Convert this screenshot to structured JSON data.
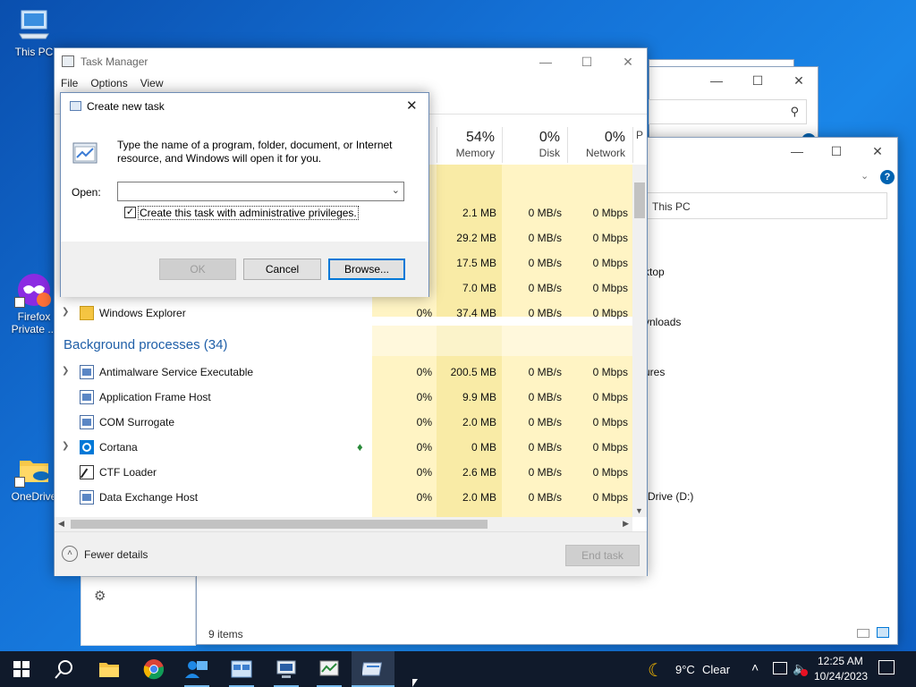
{
  "desktop": {
    "icons": [
      {
        "label": "This PC"
      },
      {
        "label": "Firefox Private ..."
      },
      {
        "label": "OneDrive"
      }
    ]
  },
  "task_manager": {
    "title": "Task Manager",
    "menu": [
      "File",
      "Options",
      "View"
    ],
    "columns": [
      {
        "pct": "54%",
        "name": "Memory"
      },
      {
        "pct": "0%",
        "name": "Disk"
      },
      {
        "pct": "0%",
        "name": "Network"
      },
      {
        "pct": "",
        "name": "P"
      }
    ],
    "apps_rows": [
      {
        "cpu": "",
        "mem": "2.1 MB",
        "disk": "0 MB/s",
        "net": "0 Mbps"
      },
      {
        "cpu": "",
        "mem": "29.2 MB",
        "disk": "0 MB/s",
        "net": "0 Mbps"
      },
      {
        "cpu": "",
        "mem": "17.5 MB",
        "disk": "0 MB/s",
        "net": "0 Mbps"
      },
      {
        "cpu": "",
        "mem": "7.0 MB",
        "disk": "0 MB/s",
        "net": "0 Mbps"
      },
      {
        "name": "Windows Explorer",
        "cpu": "0%",
        "mem": "37.4 MB",
        "disk": "0 MB/s",
        "net": "0 Mbps"
      }
    ],
    "background_header": "Background processes (34)",
    "background_rows": [
      {
        "name": "Antimalware Service Executable",
        "cpu": "0%",
        "mem": "200.5 MB",
        "disk": "0 MB/s",
        "net": "0 Mbps"
      },
      {
        "name": "Application Frame Host",
        "cpu": "0%",
        "mem": "9.9 MB",
        "disk": "0 MB/s",
        "net": "0 Mbps"
      },
      {
        "name": "COM Surrogate",
        "cpu": "0%",
        "mem": "2.0 MB",
        "disk": "0 MB/s",
        "net": "0 Mbps"
      },
      {
        "name": "Cortana",
        "cpu": "0%",
        "mem": "0 MB",
        "disk": "0 MB/s",
        "net": "0 Mbps"
      },
      {
        "name": "CTF Loader",
        "cpu": "0%",
        "mem": "2.6 MB",
        "disk": "0 MB/s",
        "net": "0 Mbps"
      },
      {
        "name": "Data Exchange Host",
        "cpu": "0%",
        "mem": "2.0 MB",
        "disk": "0 MB/s",
        "net": "0 Mbps"
      }
    ],
    "fewer_details": "Fewer details",
    "end_task": "End task"
  },
  "dialog": {
    "title": "Create new task",
    "description": "Type the name of a program, folder, document, or Internet resource, and Windows will open it for you.",
    "open_label": "Open:",
    "open_value": "",
    "admin_checkbox_label": "Create this task with administrative privileges.",
    "admin_checked": true,
    "ok": "OK",
    "cancel": "Cancel",
    "browse": "Browse..."
  },
  "explorer": {
    "address": "This PC",
    "nav_items": [
      "ktop",
      "vnloads",
      "ures",
      "Drive (D:)"
    ],
    "status": "9 items"
  },
  "taskbar": {
    "weather_temp": "9°C",
    "weather_desc": "Clear",
    "time": "12:25 AM",
    "date": "10/24/2023"
  }
}
